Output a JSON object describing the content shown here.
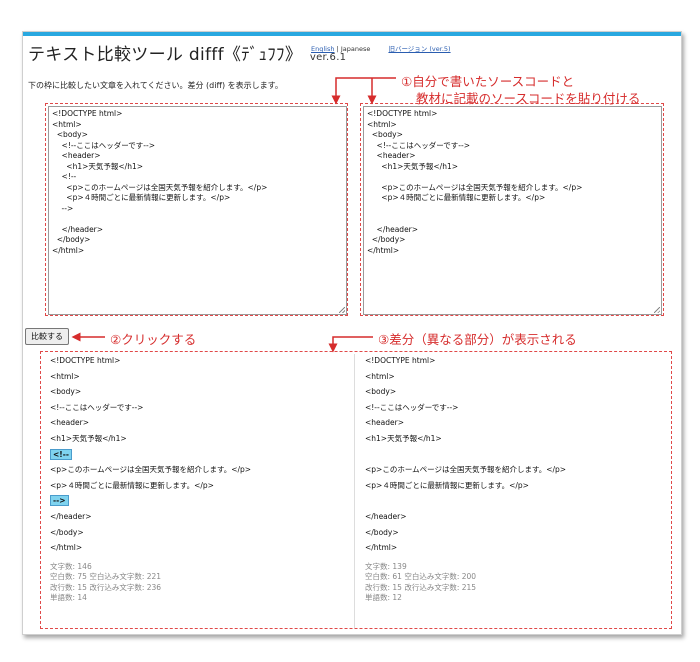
{
  "header": {
    "title": "テキスト比較ツール difff《ﾃﾞｭﾌﾌ》",
    "version": "ver.6.1",
    "lang_english": "English",
    "lang_separator": "|",
    "lang_japanese": "Japanese",
    "old_version": "旧バージョン (ver.5)"
  },
  "instruction": "下の枠に比較したい文章を入れてください。差分 (diff) を表示します。",
  "left_input": {
    "value": "<!DOCTYPE html>\n<html>\n  <body>\n    <!--ここはヘッダーです-->\n    <header>\n      <h1>天気予報</h1>\n    <!--\n      <p>このホームページは全国天気予報を紹介します。</p>\n      <p>４時間ごとに最新情報に更新します。</p>\n    -->\n\n    </header>\n  </body>\n</html>"
  },
  "right_input": {
    "value": "<!DOCTYPE html>\n<html>\n  <body>\n    <!--ここはヘッダーです-->\n    <header>\n      <h1>天気予報</h1>\n\n      <p>このホームページは全国天気予報を紹介します。</p>\n      <p>４時間ごとに最新情報に更新します。</p>\n\n\n    </header>\n  </body>\n</html>"
  },
  "compare_button": "比較する",
  "annotations": {
    "a1_line1": "①自分で書いたソースコードと",
    "a1_line2": "教材に記載のソースコードを貼り付ける",
    "a2": "②クリックする",
    "a3": "③差分（異なる部分）が表示される"
  },
  "diff_left": {
    "lines": [
      {
        "text": "<!DOCTYPE html>"
      },
      {
        "text": "<html>"
      },
      {
        "text": "<body>"
      },
      {
        "text": "<!--ここはヘッダーです-->"
      },
      {
        "text": "<header>"
      },
      {
        "text": "<h1>天気予報</h1>"
      },
      {
        "text": "<!--",
        "highlight": true
      },
      {
        "text": "<p>このホームページは全国天気予報を紹介します。</p>"
      },
      {
        "text": "<p>４時間ごとに最新情報に更新します。</p>"
      },
      {
        "text": "-->",
        "highlight": true
      },
      {
        "text": "</header>"
      },
      {
        "text": "</body>"
      },
      {
        "text": "</html>"
      }
    ],
    "stats": [
      "文字数: 146",
      "空白数: 75 空白込み文字数: 221",
      "改行数: 15 改行込み文字数: 236",
      "単語数: 14"
    ]
  },
  "diff_right": {
    "lines": [
      {
        "text": "<!DOCTYPE html>"
      },
      {
        "text": "<html>"
      },
      {
        "text": "<body>"
      },
      {
        "text": "<!--ここはヘッダーです-->"
      },
      {
        "text": "<header>"
      },
      {
        "text": "<h1>天気予報</h1>"
      },
      {
        "text": ""
      },
      {
        "text": "<p>このホームページは全国天気予報を紹介します。</p>"
      },
      {
        "text": "<p>４時間ごとに最新情報に更新します。</p>"
      },
      {
        "text": ""
      },
      {
        "text": "</header>"
      },
      {
        "text": "</body>"
      },
      {
        "text": "</html>"
      }
    ],
    "stats": [
      "文字数: 139",
      "空白数: 61 空白込み文字数: 200",
      "改行数: 15 改行込み文字数: 215",
      "単語数: 12"
    ]
  },
  "colors": {
    "accent_bar": "#29a8e0",
    "annotation": "#d62c2c",
    "highlight": "#7fd3ef",
    "link": "#2a5db0"
  }
}
